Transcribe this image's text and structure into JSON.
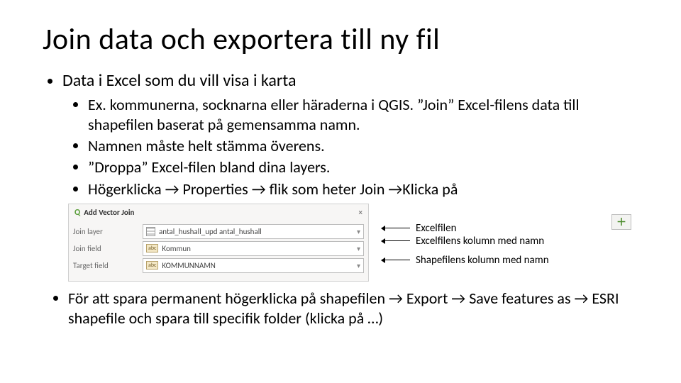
{
  "title": "Join data och exportera till ny fil",
  "bullet1": "Data i Excel som du vill visa i karta",
  "sub": [
    "Ex. kommunerna, socknarna eller häraderna i QGIS. ”Join” Excel-filens data till shapefilen baserat på gemensamma namn.",
    "Namnen måste helt stämma överens.",
    "”Droppa” Excel-filen bland dina layers.",
    "Högerklicka → Properties → flik som heter Join →Klicka på"
  ],
  "after_sub": "För att spara permanent högerklicka på shapefilen → Export → Save features as → ESRI shapefile och spara till specifik folder (klicka på …)",
  "dialog": {
    "title": "Add Vector Join",
    "rows": [
      {
        "label": "Join layer",
        "value": "antal_hushall_upd antal_hushall",
        "kind": "layer"
      },
      {
        "label": "Join field",
        "value": "Kommun",
        "kind": "abc"
      },
      {
        "label": "Target field",
        "value": "KOMMUNNAMN",
        "kind": "abc"
      }
    ],
    "close": "×",
    "add": "＋"
  },
  "annot": {
    "a1": "Excelfilen",
    "a2": "Excelfilens kolumn med namn",
    "a3": "Shapefilens kolumn med namn"
  }
}
